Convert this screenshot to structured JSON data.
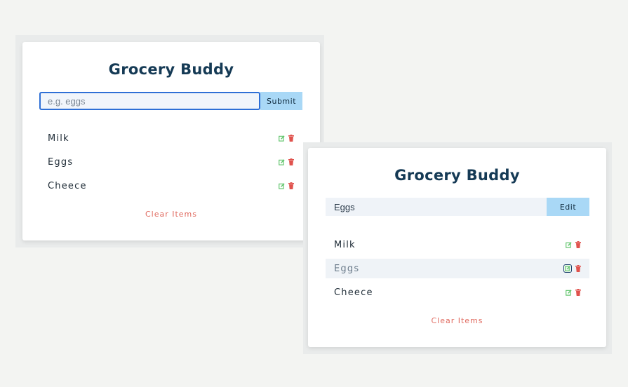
{
  "colors": {
    "background": "#f3f4f2",
    "title": "#153a55",
    "submit_bg": "#a9d8f6",
    "edit_icon": "#5fc46a",
    "delete_icon": "#e0524d",
    "clear": "#e06a5f"
  },
  "panel1": {
    "title": "Grocery Buddy",
    "input": {
      "placeholder": "e.g. eggs",
      "value": ""
    },
    "submit_label": "Submit",
    "items": [
      {
        "name": "Milk",
        "edit_icon": "edit-icon",
        "delete_icon": "trash-icon"
      },
      {
        "name": "Eggs",
        "edit_icon": "edit-icon",
        "delete_icon": "trash-icon"
      },
      {
        "name": "Cheece",
        "edit_icon": "edit-icon",
        "delete_icon": "trash-icon"
      }
    ],
    "clear_label": "Clear Items"
  },
  "panel2": {
    "title": "Grocery Buddy",
    "input": {
      "value": "Eggs"
    },
    "submit_label": "Edit",
    "items": [
      {
        "name": "Milk",
        "edit_icon": "edit-icon",
        "delete_icon": "trash-icon"
      },
      {
        "name": "Eggs",
        "edit_icon": "edit-icon",
        "delete_icon": "trash-icon",
        "editing": true
      },
      {
        "name": "Cheece",
        "edit_icon": "edit-icon",
        "delete_icon": "trash-icon"
      }
    ],
    "clear_label": "Clear Items"
  }
}
